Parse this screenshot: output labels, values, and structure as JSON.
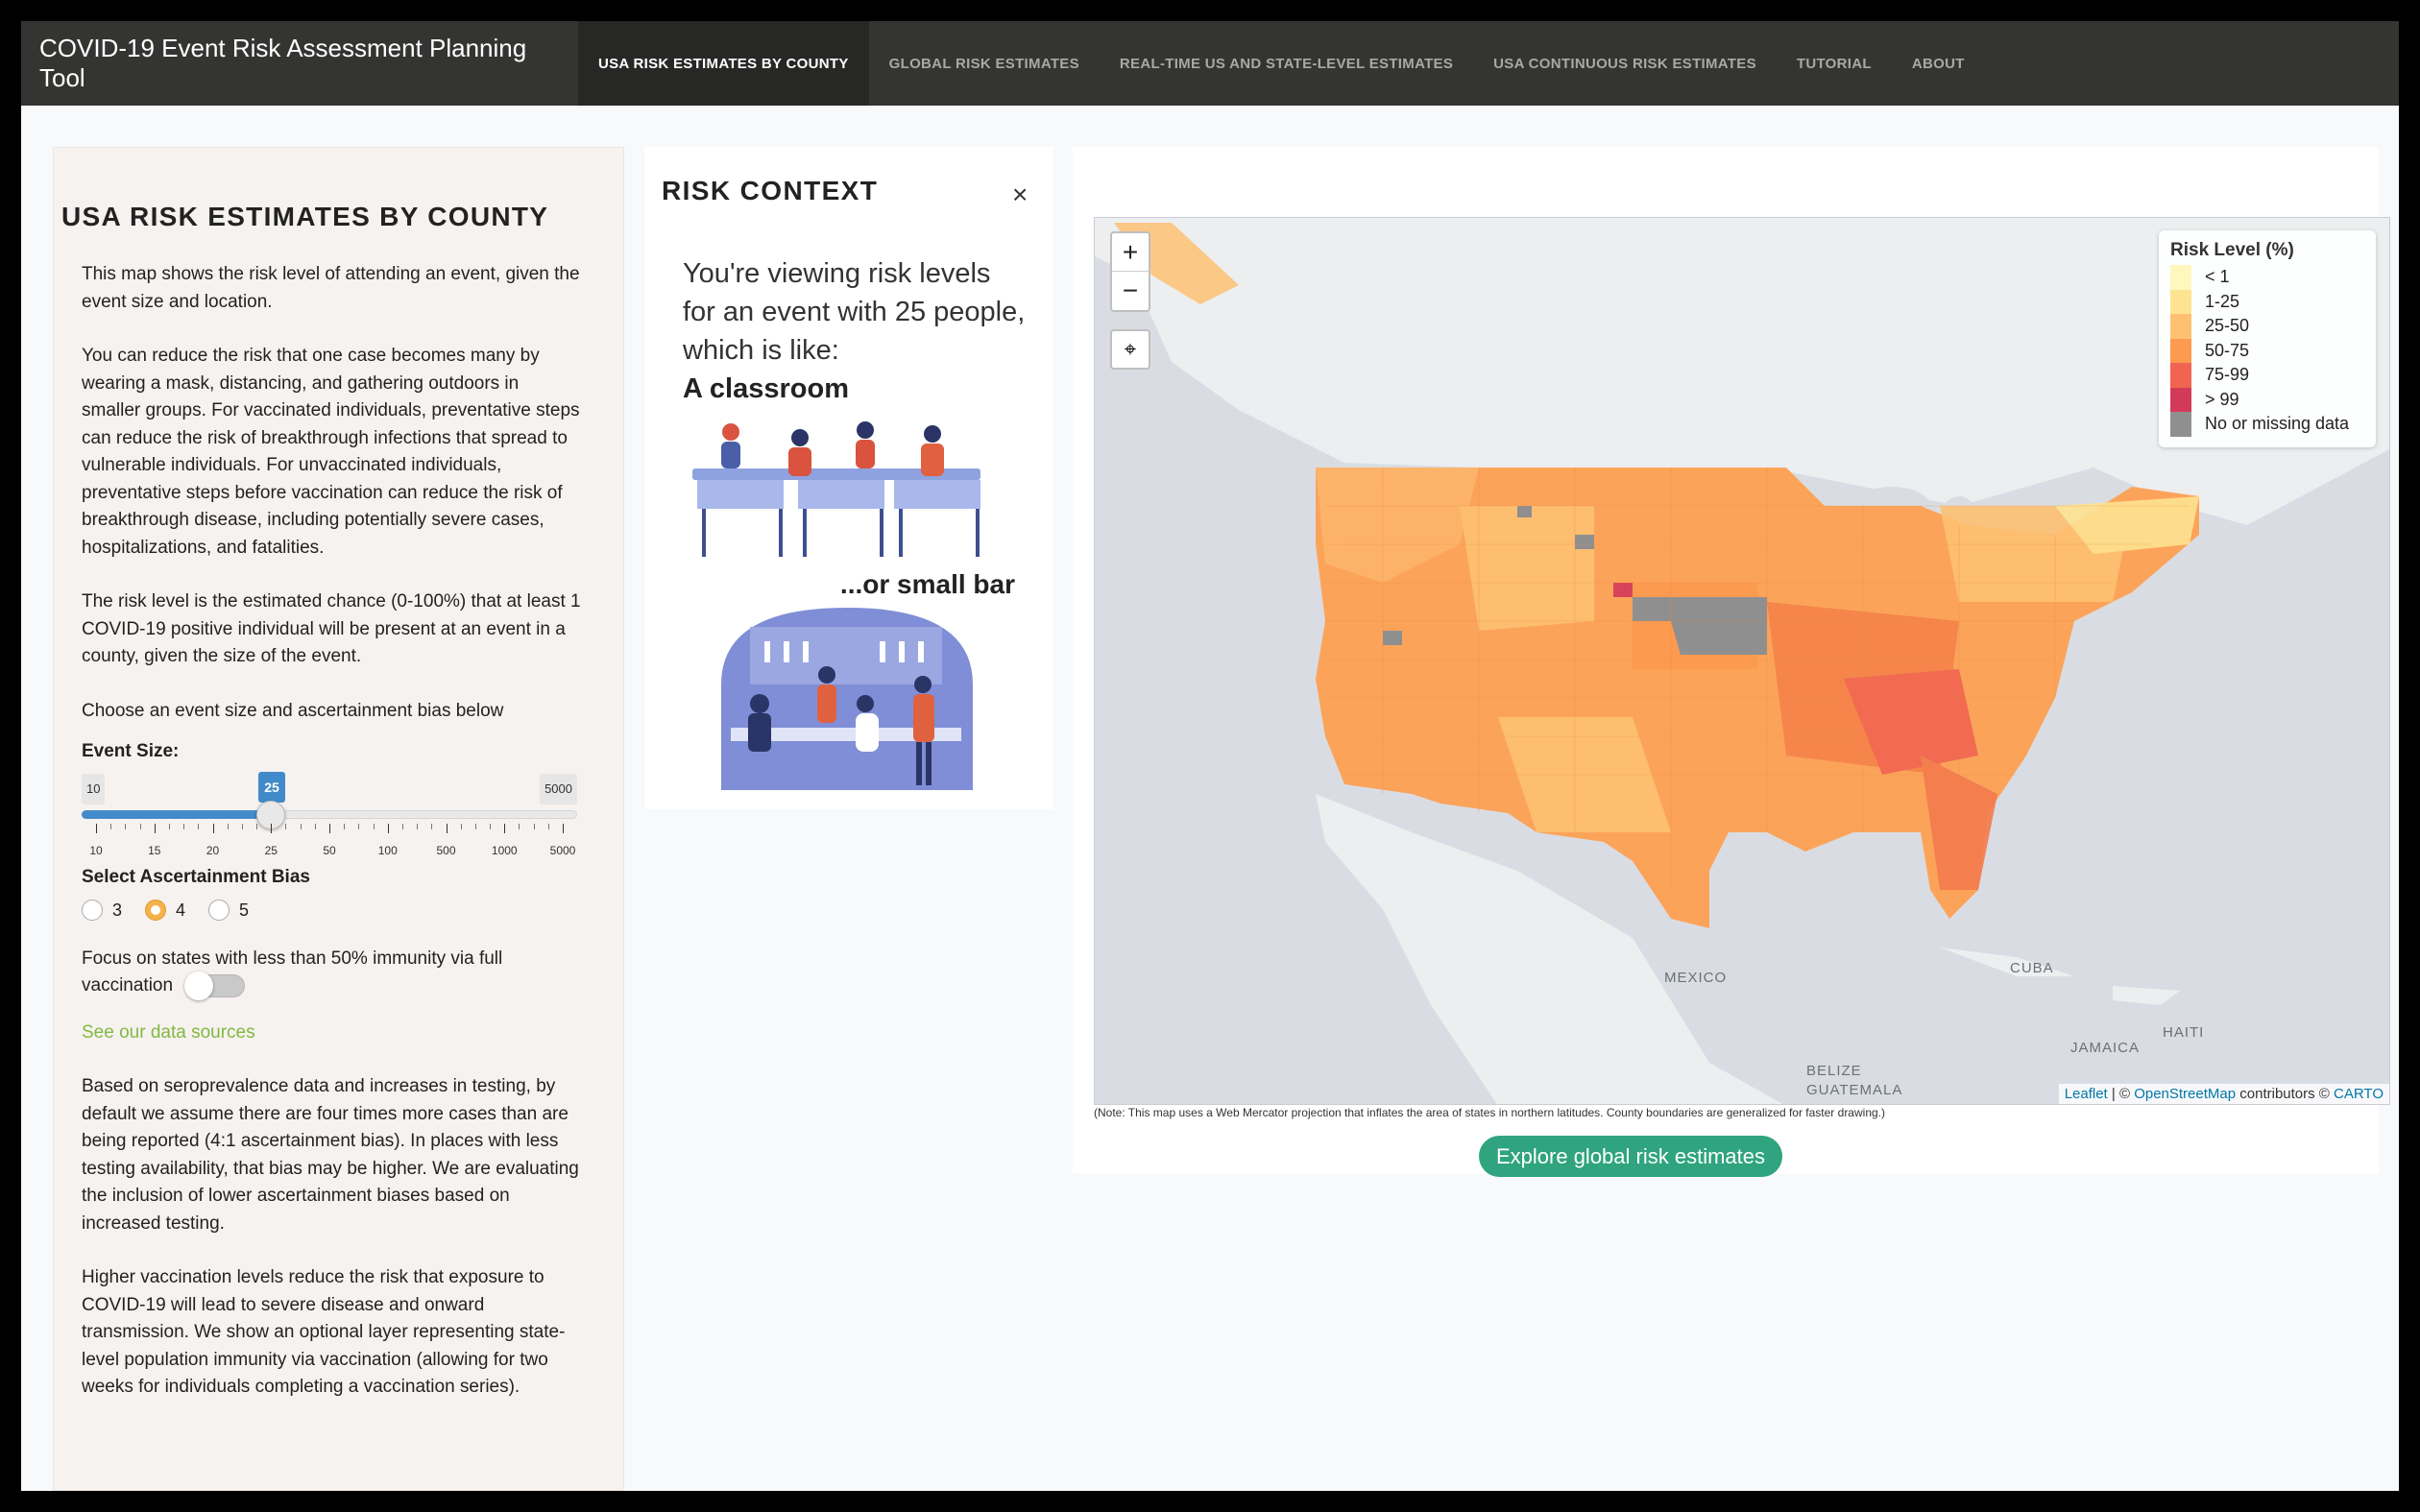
{
  "navbar": {
    "brand": "COVID-19 Event Risk Assessment Planning Tool",
    "items": [
      {
        "label": "USA RISK ESTIMATES BY COUNTY",
        "active": true
      },
      {
        "label": "GLOBAL RISK ESTIMATES",
        "active": false
      },
      {
        "label": "REAL-TIME US AND STATE-LEVEL ESTIMATES",
        "active": false
      },
      {
        "label": "USA CONTINUOUS RISK ESTIMATES",
        "active": false
      },
      {
        "label": "TUTORIAL",
        "active": false
      },
      {
        "label": "ABOUT",
        "active": false
      }
    ]
  },
  "sidebar": {
    "title": "USA RISK ESTIMATES BY COUNTY",
    "p1": "This map shows the risk level of attending an event, given the event size and location.",
    "p2": "You can reduce the risk that one case becomes many by wearing a mask, distancing, and gathering outdoors in smaller groups. For vaccinated individuals, preventative steps can reduce the risk of breakthrough infections that spread to vulnerable individuals. For unvaccinated individuals, preventative steps before vaccination can reduce the risk of breakthrough disease, including potentially severe cases, hospitalizations, and fatalities.",
    "p3": "The risk level is the estimated chance (0-100%) that at least 1 COVID-19 positive individual will be present at an event in a county, given the size of the event.",
    "p4": "Choose an event size and ascertainment bias below",
    "event_size_label": "Event Size:",
    "slider": {
      "min_label": "10",
      "max_label": "5000",
      "current_label": "25",
      "ticks": [
        "10",
        "15",
        "20",
        "25",
        "50",
        "100",
        "500",
        "1000",
        "5000"
      ],
      "selected_index": 3
    },
    "bias_label": "Select Ascertainment Bias",
    "bias_options": [
      "3",
      "4",
      "5"
    ],
    "bias_selected": "4",
    "focus_text_line1": "Focus on states with less than 50% immunity via full",
    "focus_text_line2": "vaccination",
    "focus_enabled": false,
    "data_sources_link": "See our data sources",
    "p5": "Based on seroprevalence data and increases in testing, by default we assume there are four times more cases than are being reported (4:1 ascertainment bias). In places with less testing availability, that bias may be higher. We are evaluating the inclusion of lower ascertainment biases based on increased testing.",
    "p6": "Higher vaccination levels reduce the risk that exposure to COVID-19 will lead to severe disease and onward transmission. We show an optional layer representing state-level population immunity via vaccination (allowing for two weeks for individuals completing a vaccination series)."
  },
  "context": {
    "title": "RISK CONTEXT",
    "close": "×",
    "desc": "You're viewing risk levels for an event with 25 people, which is like:",
    "example": "A classroom",
    "alt_example": "...or small bar"
  },
  "map": {
    "zoom_in": "+",
    "zoom_out": "−",
    "legend_title": "Risk Level (%)",
    "legend": [
      {
        "label": "< 1",
        "color": "#fff7bc"
      },
      {
        "label": "1-25",
        "color": "#fee391"
      },
      {
        "label": "25-50",
        "color": "#fec172"
      },
      {
        "label": "50-75",
        "color": "#fc9a4f"
      },
      {
        "label": "75-99",
        "color": "#f06451"
      },
      {
        "label": "> 99",
        "color": "#d33a5a"
      },
      {
        "label": "No or missing data",
        "color": "#8f8f8f"
      }
    ],
    "labels": {
      "mexico": "MEXICO",
      "cuba": "CUBA",
      "jamaica": "JAMAICA",
      "haiti": "HAITI",
      "belize": "BELIZE",
      "guatemala": "GUATEMALA"
    },
    "attribution_leaflet": "Leaflet",
    "attribution_sep": " | © ",
    "attribution_osm": "OpenStreetMap",
    "attribution_contrib": " contributors © ",
    "attribution_carto": "CARTO",
    "note": "(Note: This map uses a Web Mercator projection that inflates the area of states in northern latitudes. County boundaries are generalized for faster drawing.)",
    "explore_button": "Explore global risk estimates"
  }
}
